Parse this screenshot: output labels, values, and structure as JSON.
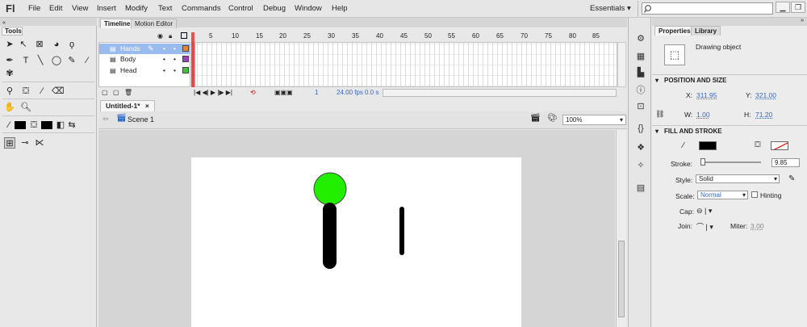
{
  "app": {
    "logo": "Fl"
  },
  "menu": [
    "File",
    "Edit",
    "View",
    "Insert",
    "Modify",
    "Text",
    "Commands",
    "Control",
    "Debug",
    "Window",
    "Help"
  ],
  "workspace": {
    "label": "Essentials",
    "arrow": "▾"
  },
  "tools": {
    "title": "Tools"
  },
  "timeline": {
    "tabs": [
      "Timeline",
      "Motion Editor"
    ],
    "ruler": [
      "1",
      "5",
      "10",
      "15",
      "20",
      "25",
      "30",
      "35",
      "40",
      "45",
      "50",
      "55",
      "60",
      "65",
      "70",
      "75",
      "80",
      "85"
    ],
    "layers": [
      {
        "name": "Hands",
        "color": "#e8872a"
      },
      {
        "name": "Body",
        "color": "#a040c0"
      },
      {
        "name": "Head",
        "color": "#40c040"
      }
    ],
    "status": {
      "frame": "1",
      "fps": "24.00 fps",
      "time": "0.0 s"
    }
  },
  "document": {
    "tab": "Untitled-1*",
    "close": "×",
    "scene": "Scene 1",
    "zoom": "100%"
  },
  "stage": {
    "head_color": "#22ee00",
    "body_color": "#000000"
  },
  "properties": {
    "tabs": [
      "Properties",
      "Library"
    ],
    "object_type": "Drawing object",
    "position_size": {
      "title": "POSITION AND SIZE",
      "x_label": "X:",
      "x": "311.95",
      "y_label": "Y:",
      "y": "321.00",
      "w_label": "W:",
      "w": "1.00",
      "h_label": "H:",
      "h": "71.20"
    },
    "fill_stroke": {
      "title": "FILL AND STROKE",
      "stroke_label": "Stroke:",
      "stroke": "9.85",
      "style_label": "Style:",
      "style": "Solid",
      "scale_label": "Scale:",
      "scale": "Normal",
      "hinting_label": "Hinting",
      "cap_label": "Cap:",
      "join_label": "Join:",
      "miter_label": "Miter:",
      "miter": "3.00"
    }
  }
}
